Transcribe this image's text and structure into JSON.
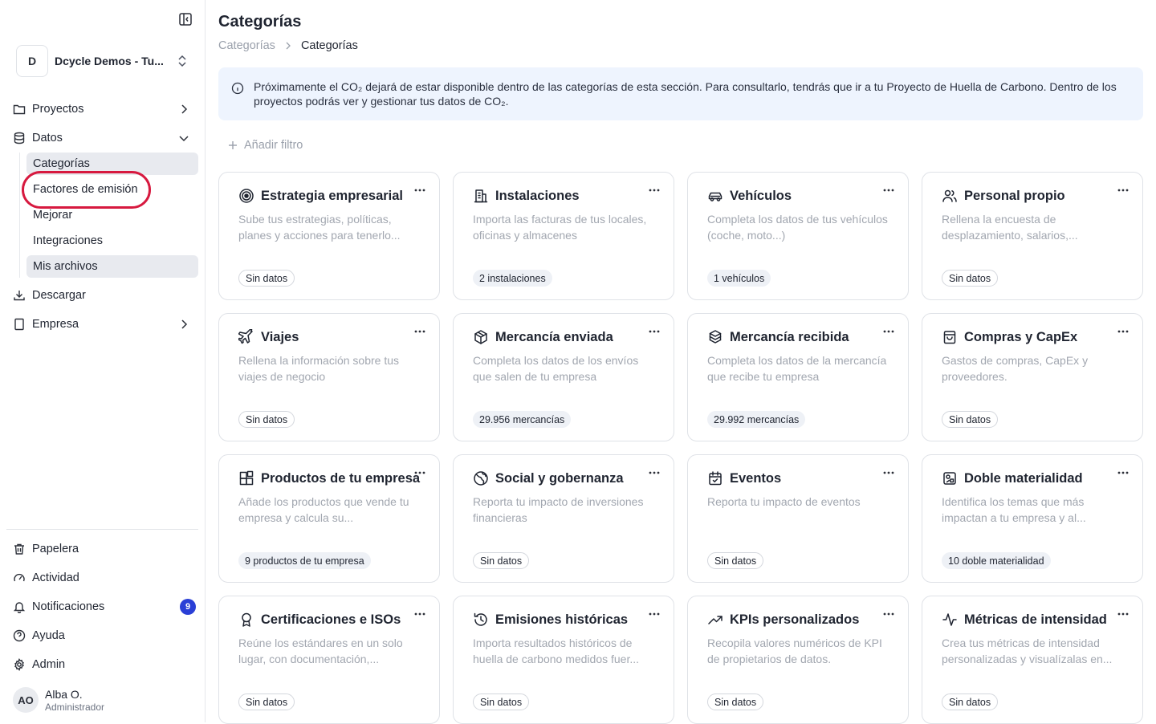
{
  "sidebar": {
    "org": {
      "initial": "D",
      "name": "Dcycle Demos - Tu..."
    },
    "nav": {
      "proyectos": "Proyectos",
      "datos": "Datos",
      "descargar": "Descargar",
      "empresa": "Empresa"
    },
    "datos_sub": {
      "categorias": "Categorías",
      "factores": "Factores de emisión",
      "mejorar": "Mejorar",
      "integraciones": "Integraciones",
      "archivos": "Mis archivos"
    },
    "bottom": {
      "papelera": "Papelera",
      "actividad": "Actividad",
      "notificaciones": "Notificaciones",
      "notif_count": "9",
      "ayuda": "Ayuda",
      "admin": "Admin"
    },
    "user": {
      "initials": "AO",
      "name": "Alba O.",
      "role": "Administrador"
    }
  },
  "header": {
    "title": "Categorías",
    "breadcrumb": [
      "Categorías",
      "Categorías"
    ]
  },
  "info_banner": "Próximamente el CO₂ dejará de estar disponible dentro de las categorías de esta sección. Para consultarlo, tendrás que ir a tu Proyecto de Huella de Carbono. Dentro de los proyectos podrás ver y gestionar tus datos de CO₂.",
  "filter": {
    "add_label": "Añadir filtro"
  },
  "cards": [
    {
      "title": "Estrategia empresarial",
      "desc": "Sube tus estrategias, políticas, planes y acciones para tenerlo...",
      "tag": "Sin datos",
      "icon": "target-icon"
    },
    {
      "title": "Instalaciones",
      "desc": "Importa las facturas de tus locales, oficinas y almacenes",
      "tag": "2 instalaciones",
      "icon": "building-icon"
    },
    {
      "title": "Vehículos",
      "desc": "Completa los datos de tus vehículos (coche, moto...)",
      "tag": "1 vehículos",
      "icon": "car-icon"
    },
    {
      "title": "Personal propio",
      "desc": "Rellena la encuesta de desplazamiento, salarios,...",
      "tag": "Sin datos",
      "icon": "users-icon"
    },
    {
      "title": "Viajes",
      "desc": "Rellena la información sobre tus viajes de negocio",
      "tag": "Sin datos",
      "icon": "plane-icon"
    },
    {
      "title": "Mercancía enviada",
      "desc": "Completa los datos de los envíos que salen de tu empresa",
      "tag": "29.956 mercancías",
      "icon": "box-icon"
    },
    {
      "title": "Mercancía recibida",
      "desc": "Completa los datos de la mercancía que recibe tu empresa",
      "tag": "29.992 mercancías",
      "icon": "boxes-icon"
    },
    {
      "title": "Compras y CapEx",
      "desc": "Gastos de compras, CapEx y proveedores.",
      "tag": "Sin datos",
      "icon": "shopping-bag-icon"
    },
    {
      "title": "Productos de tu empresa",
      "desc": "Añade los productos que vende tu empresa y calcula su...",
      "tag": "9 productos de tu empresa",
      "icon": "products-icon"
    },
    {
      "title": "Social y gobernanza",
      "desc": "Reporta tu impacto de inversiones financieras",
      "tag": "Sin datos",
      "icon": "globe-icon"
    },
    {
      "title": "Eventos",
      "desc": "Reporta tu impacto de eventos",
      "tag": "Sin datos",
      "icon": "calendar-icon"
    },
    {
      "title": "Doble materialidad",
      "desc": "Identifica los temas que más impactan a tu empresa y al...",
      "tag": "10 doble materialidad",
      "icon": "materiality-icon"
    },
    {
      "title": "Certificaciones e ISOs",
      "desc": "Reúne los estándares en un solo lugar, con documentación,...",
      "tag": "Sin datos",
      "icon": "award-icon"
    },
    {
      "title": "Emisiones históricas",
      "desc": "Importa resultados históricos de huella de carbono medidos fuer...",
      "tag": "Sin datos",
      "icon": "history-icon"
    },
    {
      "title": "KPIs personalizados",
      "desc": "Recopila valores numéricos de KPI de propietarios de datos.",
      "tag": "Sin datos",
      "icon": "trending-up-icon"
    },
    {
      "title": "Métricas de intensidad",
      "desc": "Crea tus métricas de intensidad personalizadas y visualízalas en...",
      "tag": "Sin datos",
      "icon": "activity-icon"
    }
  ]
}
